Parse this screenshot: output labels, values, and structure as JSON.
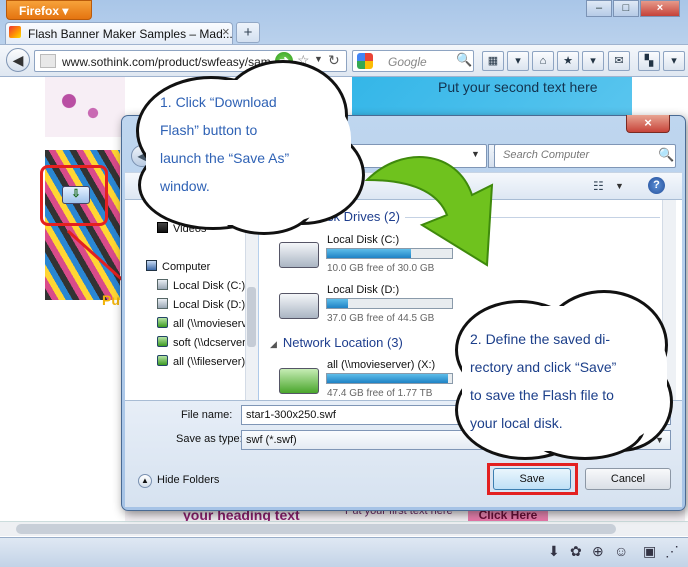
{
  "browser": {
    "menu_label": "Firefox",
    "tab_title": "Flash Banner Maker Samples – Mad...",
    "url": "www.sothink.com/product/swfeasy/sam",
    "search_placeholder": "Google",
    "window_buttons": [
      "–",
      "□",
      "×"
    ]
  },
  "webpage": {
    "banner_text": "Put your second text here",
    "left_text": "Pu",
    "bottom_heading": "your heading text",
    "bottom_subtext": "Put your first text here",
    "bottom_button": "Click Here"
  },
  "dialog": {
    "search_placeholder": "Search Computer",
    "nav_items": [
      {
        "label": "Videos",
        "icon": "videos-icon"
      },
      {
        "label": "Computer",
        "icon": "computer-icon"
      },
      {
        "label": "Local Disk (C:)",
        "icon": "disk-icon"
      },
      {
        "label": "Local Disk (D:)",
        "icon": "disk-icon"
      },
      {
        "label": "all (\\\\movieserver)",
        "icon": "network-drive-icon"
      },
      {
        "label": "soft (\\\\dcserver)",
        "icon": "network-drive-icon"
      },
      {
        "label": "all (\\\\fileserver)",
        "icon": "network-drive-icon"
      }
    ],
    "groups": {
      "hard_disks": "Hard Disk Drives (2)",
      "network": "Network Location (3)"
    },
    "drives": [
      {
        "name": "Local Disk (C:)",
        "free": "10.0 GB free of 30.0 GB",
        "used_fraction": 0.67
      },
      {
        "name": "Local Disk (D:)",
        "free": "37.0 GB free of 44.5 GB",
        "used_fraction": 0.17
      },
      {
        "name": "all (\\\\movieserver) (X:)",
        "free": "47.4 GB free of 1.77 TB",
        "used_fraction": 0.97
      }
    ],
    "file_name_label": "File name:",
    "file_name_value": "star1-300x250.swf",
    "save_type_label": "Save as type:",
    "save_type_value": "swf (*.swf)",
    "hide_folders": "Hide Folders",
    "save_button": "Save",
    "cancel_button": "Cancel"
  },
  "callouts": {
    "step1": [
      "1. Click “Download",
      "Flash” button to",
      "launch the “Save As”",
      "window."
    ],
    "step2": [
      "2. Define the saved di-",
      "rectory and click “Save”",
      "to save the Flash file to",
      "your local disk."
    ]
  },
  "colors": {
    "highlight_red": "#e32020",
    "callout_text": "#2f62b5",
    "arrow_green": "#6fc21e"
  }
}
